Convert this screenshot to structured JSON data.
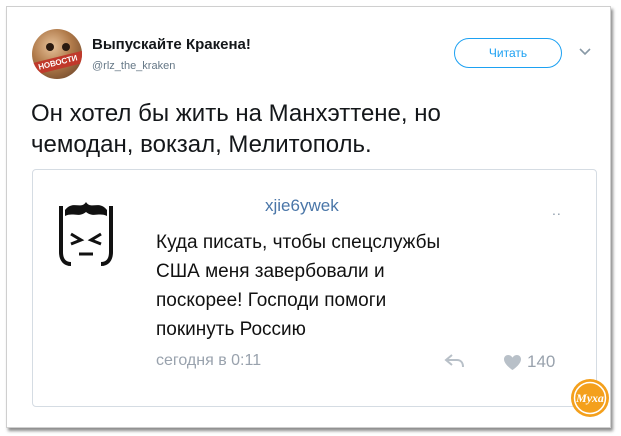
{
  "tweet": {
    "author_name": "Выпускайте Кракена!",
    "author_handle": "@rlz_the_kraken",
    "avatar_badge": "НОВОСТИ",
    "follow_label": "Читать",
    "text_line1": "Он хотел бы жить на Манхэттене, но",
    "text_line2": "чемодан, вокзал, Мелитополь."
  },
  "embedded_post": {
    "username": "xjie6ywek",
    "dots": "..",
    "text_line1": "Куда писать, чтобы спецслужбы",
    "text_line2": "США меня завербовали и",
    "text_line3": "поскорее! Господи помоги",
    "text_line4": "покинуть Россию",
    "time": "сегодня в 0:11",
    "likes": "140"
  },
  "watermark": {
    "text": "Муха"
  },
  "colors": {
    "accent": "#1da1f2",
    "vk_link": "#4a76a8",
    "meta": "#99a2ad",
    "watermark": "#f4a01c"
  },
  "icons": [
    "avatar",
    "chevron-down-icon",
    "cartoon-avatar",
    "reply-icon",
    "heart-icon",
    "muha-logo"
  ]
}
